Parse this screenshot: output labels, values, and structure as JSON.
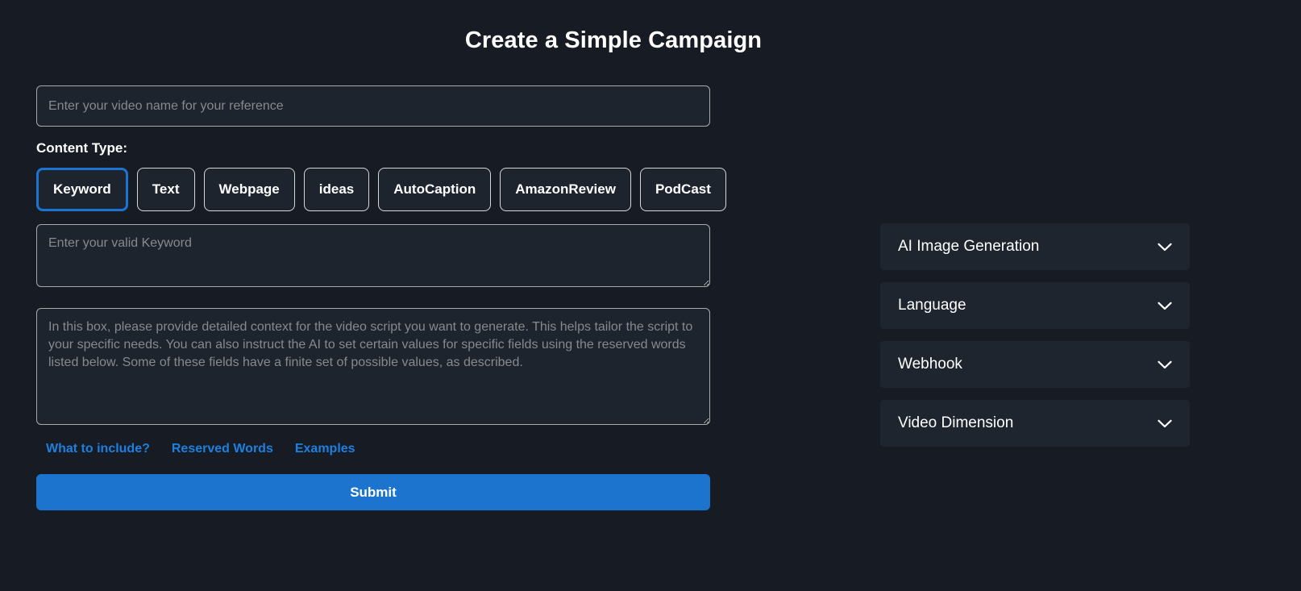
{
  "page": {
    "title": "Create a Simple Campaign",
    "background_color": "#171c24",
    "accent_color": "#1d74cf",
    "link_color": "#1d7fe0",
    "panel_color": "#1f252f",
    "input_background": "#1e242e",
    "selected_border_color": "#1b74d1"
  },
  "form": {
    "video_name": {
      "value": "",
      "placeholder": "Enter your video name for your reference"
    },
    "content_type_label": "Content Type:",
    "content_types": [
      {
        "label": "Keyword",
        "selected": true
      },
      {
        "label": "Text",
        "selected": false
      },
      {
        "label": "Webpage",
        "selected": false
      },
      {
        "label": "ideas",
        "selected": false
      },
      {
        "label": "AutoCaption",
        "selected": false
      },
      {
        "label": "AmazonReview",
        "selected": false
      },
      {
        "label": "PodCast",
        "selected": false
      }
    ],
    "keyword": {
      "value": "",
      "placeholder": "Enter your valid Keyword"
    },
    "context": {
      "value": "",
      "placeholder": "In this box, please provide detailed context for the video script you want to generate. This helps tailor the script to your specific needs. You can also instruct the AI to set certain values for specific fields using the reserved words listed below. Some of these fields have a finite set of possible values, as described."
    },
    "links": [
      {
        "label": "What to include?"
      },
      {
        "label": "Reserved Words"
      },
      {
        "label": "Examples"
      }
    ],
    "submit_label": "Submit"
  },
  "accordion": {
    "items": [
      {
        "label": "AI Image Generation",
        "icon": "chevron-down-icon",
        "expanded": false
      },
      {
        "label": "Language",
        "icon": "chevron-down-icon",
        "expanded": false
      },
      {
        "label": "Webhook",
        "icon": "chevron-down-icon",
        "expanded": false
      },
      {
        "label": "Video Dimension",
        "icon": "chevron-down-icon",
        "expanded": false
      }
    ]
  }
}
